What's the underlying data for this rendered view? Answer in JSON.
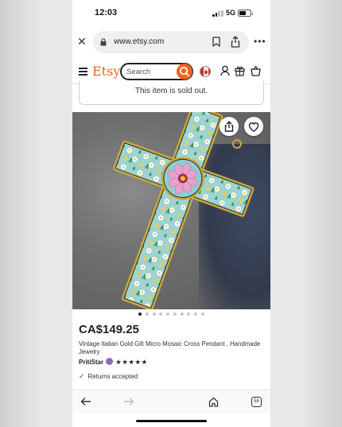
{
  "status": {
    "time": "12:03",
    "network": "5G"
  },
  "browser": {
    "url": "www.etsy.com"
  },
  "header": {
    "logo": "Etsy",
    "search_placeholder": "Search",
    "accent": "#f1641e"
  },
  "banner": {
    "text": "This item is sold out."
  },
  "carousel": {
    "total": 10,
    "active": 0
  },
  "product": {
    "price": "CA$149.25",
    "title": "Vintage Italian Gold Gilt Micro Mosaic Cross Pendant . Handmade Jewelry",
    "shop": "PritiStar",
    "stars": "★★★★★",
    "rating": 5,
    "returns": "Returns accepted"
  },
  "toolbar": {
    "tabs_count": "58"
  }
}
